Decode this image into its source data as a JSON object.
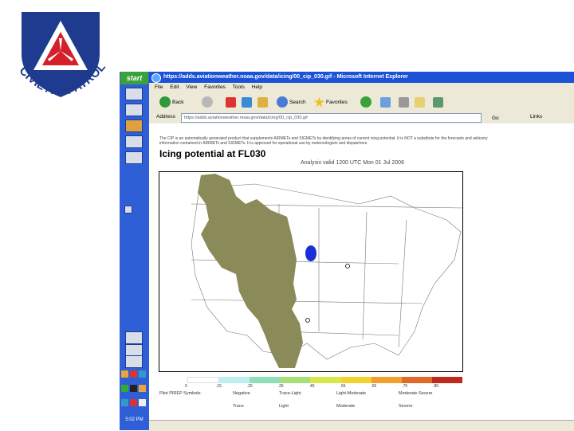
{
  "logo": {
    "text": "CIVIL AIR PATROL"
  },
  "taskbar": {
    "start": "start",
    "clock": "5:02 PM"
  },
  "window": {
    "title": "https://adds.aviationweather.noaa.gov/data/icing/00_cip_030.gif - Microsoft Internet Explorer",
    "menu": [
      "File",
      "Edit",
      "View",
      "Favorites",
      "Tools",
      "Help"
    ],
    "toolbar": {
      "back": "Back",
      "search": "Search",
      "favorites": "Favorites"
    },
    "address": {
      "label": "Address",
      "value": "https://adds.aviationweather.noaa.gov/data/icing/00_cip_030.gif",
      "go": "Go",
      "links": "Links"
    }
  },
  "content": {
    "banner": "The CIP is an automatically generated product that supplements AIRMETs and SIGMETs by identifying areas of current icing potential. It is NOT a substitute for the forecasts and advisory information contained in AIRMETs and SIGMETs. It is approved for operational use by meteorologists and dispatchers.",
    "plot_title": "Icing potential at FL030",
    "valid": "Analysis valid 1200 UTC Mon 01 Jul 2006",
    "legend_labels": [
      "0",
      ".15",
      ".25",
      ".35",
      ".45",
      ".55",
      ".65",
      ".75",
      ".85"
    ],
    "symbols": {
      "header": "Pilot PIREP Symbols:",
      "negative": "Negative",
      "trace_light": "Trace-Light",
      "light_moderate": "Light-Moderate",
      "moderate_severe": "Moderate-Severe",
      "trace": "Trace",
      "light": "Light",
      "moderate": "Moderate",
      "severe": "Severe"
    }
  },
  "colors": {
    "taskbar": "#2f5fd6",
    "titlebar": "#1c53d6",
    "icing_area": "#8b8a59",
    "pirep_blob": "#1a2fd6",
    "legend": [
      "#ffffff",
      "#bff0ef",
      "#8fe0b8",
      "#a7e07a",
      "#d8e84a",
      "#f2d22c",
      "#f0a030",
      "#e06a28",
      "#c02a1c"
    ]
  }
}
